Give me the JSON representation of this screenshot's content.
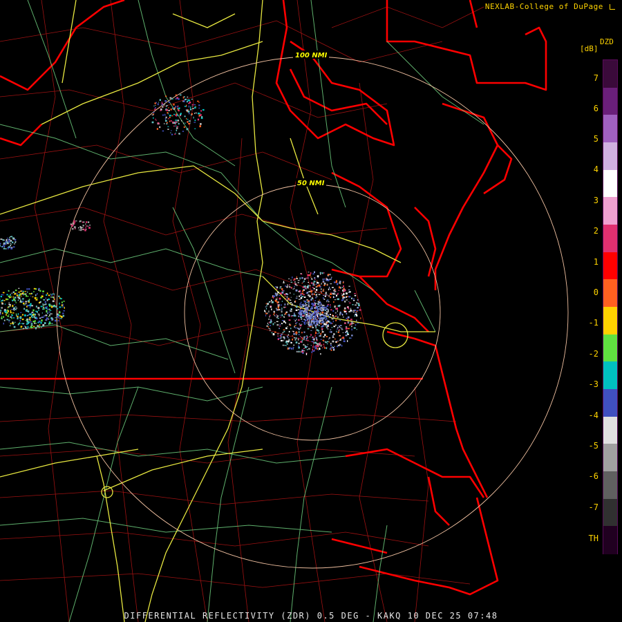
{
  "header": {
    "credit": "NEXLAB-College of DuPage",
    "credit_icon": "resize-corner-icon"
  },
  "legend": {
    "product": "DZD",
    "unit": "[dB]",
    "ticks": [
      "7",
      "6",
      "5",
      "4",
      "3",
      "2",
      "1",
      "0",
      "-1",
      "-2",
      "-3",
      "-4",
      "-5",
      "-6",
      "-7",
      "TH"
    ],
    "colors": [
      "#3a0a3a",
      "#6a1f7a",
      "#a060c0",
      "#d0b0e0",
      "#ffffff",
      "#f0a0d0",
      "#e03070",
      "#ff0000",
      "#ff6020",
      "#ffd000",
      "#60e040",
      "#00c0c0",
      "#4050c0",
      "#e0e0e0",
      "#a0a0a0",
      "#606060",
      "#303030",
      "#200020"
    ]
  },
  "rings": {
    "inner_label": "50 NMI",
    "outer_label": "100 NMI"
  },
  "footer": {
    "caption": "DIFFERENTIAL REFLECTIVITY (ZDR) 0.5 DEG - KAKQ 10 DEC 25 07:48"
  },
  "colors": {
    "state_border": "#ff0000",
    "county": "#c01818",
    "road": "#e0e040",
    "highway": "#60d080",
    "range_ring": "#f0c0a0",
    "text": "#ffd400"
  }
}
